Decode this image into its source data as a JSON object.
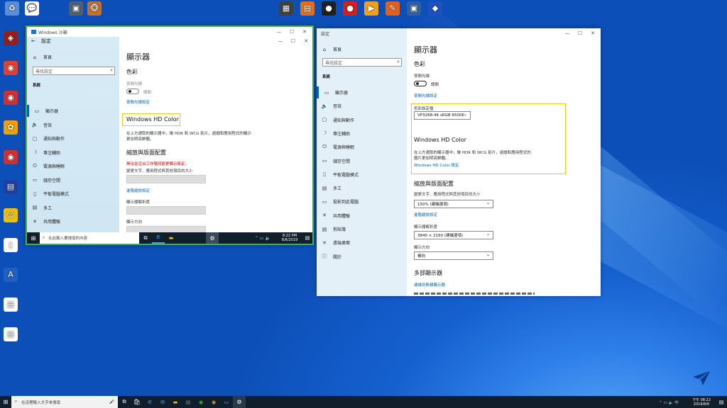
{
  "desktop": {
    "top_icons": [
      {
        "name": "shortcut",
        "label": "",
        "glyph": "♻",
        "color": "#5a8fd8"
      },
      {
        "name": "chat",
        "label": "",
        "glyph": "💬",
        "color": "#ffffff"
      },
      {
        "name": "app",
        "label": "",
        "glyph": "▣",
        "color": "#506070"
      },
      {
        "name": "monkey",
        "label": "",
        "glyph": "🐵",
        "color": "#c07030"
      }
    ],
    "top_right_icons": [
      {
        "name": "a1",
        "label": "",
        "glyph": "▦",
        "color": "#404040"
      },
      {
        "name": "a2",
        "label": "",
        "glyph": "▤",
        "color": "#e07020"
      },
      {
        "name": "a3",
        "label": "",
        "glyph": "●",
        "color": "#202020"
      },
      {
        "name": "a4",
        "label": "",
        "glyph": "●",
        "color": "#d02020"
      },
      {
        "name": "a5",
        "label": "",
        "glyph": "▶",
        "color": "#f0a020"
      },
      {
        "name": "a6",
        "label": "",
        "glyph": "✎",
        "color": "#e06020"
      },
      {
        "name": "a7",
        "label": "",
        "glyph": "▣",
        "color": "#3060a0"
      },
      {
        "name": "a8",
        "label": "",
        "glyph": "◆",
        "color": "#2050c0"
      }
    ],
    "left_icons": [
      {
        "name": "l1",
        "label": "",
        "glyph": "◈",
        "color": "#902020"
      },
      {
        "name": "l2",
        "label": "",
        "glyph": "◉",
        "color": "#e04030"
      },
      {
        "name": "l3",
        "label": "",
        "glyph": "◉",
        "color": "#d03030"
      },
      {
        "name": "l4",
        "label": "",
        "glyph": "✿",
        "color": "#f0a000"
      },
      {
        "name": "l5",
        "label": "",
        "glyph": "◉",
        "color": "#d03030"
      },
      {
        "name": "l6",
        "label": "",
        "glyph": "▤",
        "color": "#2040a0"
      },
      {
        "name": "l7",
        "label": "",
        "glyph": "☺",
        "color": "#f0c000"
      },
      {
        "name": "l8",
        "label": "",
        "glyph": "▯",
        "color": "#ffffff"
      },
      {
        "name": "l9",
        "label": "",
        "glyph": "A",
        "color": "#2060c0"
      },
      {
        "name": "l10",
        "label": "",
        "glyph": "▤",
        "color": "#ffffff"
      },
      {
        "name": "l11",
        "label": "",
        "glyph": "▤",
        "color": "#ffffff"
      }
    ]
  },
  "small_window": {
    "outer_title": "Windows 沙箱",
    "app_title": "設定",
    "home": "首頁",
    "search_placeholder": "尋找設定",
    "section": "系統",
    "nav": [
      {
        "label": "顯示器",
        "glyph": "▭"
      },
      {
        "label": "音效",
        "glyph": "🔈"
      },
      {
        "label": "通知與動作",
        "glyph": "▢"
      },
      {
        "label": "專注輔助",
        "glyph": "☽"
      },
      {
        "label": "電源與睡眠",
        "glyph": "⏻"
      },
      {
        "label": "儲存空間",
        "glyph": "▭"
      },
      {
        "label": "平板電腦模式",
        "glyph": "▯"
      },
      {
        "label": "多工",
        "glyph": "▤"
      },
      {
        "label": "共用體驗",
        "glyph": "✕"
      },
      {
        "label": "剪貼簿",
        "glyph": "▤"
      }
    ],
    "heading": "顯示器",
    "color_heading": "色彩",
    "night_light": "夜間光線",
    "toggle_state": "關閉",
    "night_light_link": "夜間光線設定",
    "hd_title": "Windows HD Color",
    "hd_desc1": "在上方選取的顯示器中，讓 HDR 和 WCG 影片，遊戲和應用程式的顯示",
    "hd_desc2": "更加明亮鮮豔。",
    "scale_heading": "縮放與版面配置",
    "warn": "無法從這台工作階段變更顯示設定。",
    "scale_label": "變更文字、應用程式與其他項目的大小",
    "advanced_link": "進階縮放設定",
    "res_label": "顯示器解析度",
    "orient_label": "顯示方向",
    "taskbar_search": "在此輸入要搜尋的內容",
    "time": "8:22 PM",
    "date": "8/6/2019"
  },
  "big_window": {
    "app_title": "設定",
    "home": "首頁",
    "search_placeholder": "尋找設定",
    "section": "系統",
    "nav": [
      {
        "label": "顯示器",
        "glyph": "▭"
      },
      {
        "label": "音效",
        "glyph": "🔈"
      },
      {
        "label": "通知與動作",
        "glyph": "▢"
      },
      {
        "label": "專注輔助",
        "glyph": "☽"
      },
      {
        "label": "電源與睡眠",
        "glyph": "⏻"
      },
      {
        "label": "儲存空間",
        "glyph": "▭"
      },
      {
        "label": "平板電腦模式",
        "glyph": "▯"
      },
      {
        "label": "多工",
        "glyph": "▤"
      },
      {
        "label": "投影到此電腦",
        "glyph": "▭"
      },
      {
        "label": "共用體驗",
        "glyph": "✕"
      },
      {
        "label": "剪貼簿",
        "glyph": "▤"
      },
      {
        "label": "遠端桌面",
        "glyph": "✕"
      },
      {
        "label": "關於",
        "glyph": "ⓘ"
      }
    ],
    "heading": "顯示器",
    "color_heading": "色彩",
    "night_light": "夜間光線",
    "toggle_state": "關閉",
    "night_light_link": "夜間光線設定",
    "profile_label": "色彩設定檔",
    "profile_value": "VP3268-4K sRGB 6500K",
    "hd_title": "Windows HD Color",
    "hd_desc1": "在上方選取的顯示器中，讓 HDR 和 WCG 影片，遊戲和應用程式的",
    "hd_desc2": "圖片更加明亮鮮豔。",
    "hd_link": "Windows HD Color 設定",
    "scale_heading": "縮放與版面配置",
    "scale_label": "變更文字、應用程式與其他項目的大小",
    "scale_value": "150% (建議選項)",
    "advanced_link": "進階縮放設定",
    "res_label": "顯示器解析度",
    "res_value": "3840 × 2160 (建議選項)",
    "orient_label": "顯示方向",
    "orient_value": "橫向",
    "multi_heading": "多部顯示器",
    "wireless_link": "連線到無線顯示器"
  },
  "taskbar": {
    "search_placeholder": "在這裡輸入文字來搜尋",
    "time": "下午 08:22",
    "date": "2019/8/6"
  },
  "colors": {
    "highlight": "#f5c518",
    "link": "#0063b1",
    "sidebar": "#e4f0f8",
    "taskbar": "#111e2c"
  }
}
